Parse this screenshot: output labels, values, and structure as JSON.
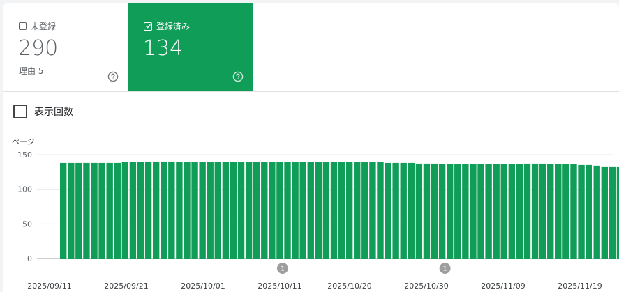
{
  "tiles": {
    "not_indexed": {
      "label": "未登録",
      "value": "290",
      "sub": "理由 5",
      "help_icon": "help-circle-icon"
    },
    "indexed": {
      "label": "登録済み",
      "value": "134",
      "help_icon": "help-circle-icon"
    }
  },
  "metric_toggle": {
    "label": "表示回数",
    "checked": false
  },
  "colors": {
    "accent": "#0f9d58",
    "bar": "#0f9d58",
    "grid": "#e8eaed",
    "annotation": "#9e9e9e"
  },
  "chart_data": {
    "type": "bar",
    "ylabel": "ページ",
    "ylim": [
      0,
      150
    ],
    "yticks": [
      "0",
      "50",
      "100",
      "150"
    ],
    "xtick_labels": [
      "2025/09/11",
      "2025/09/21",
      "2025/10/01",
      "2025/10/11",
      "2025/10/20",
      "2025/10/30",
      "2025/11/09",
      "2025/11/19"
    ],
    "series": [
      {
        "values": [
          138,
          138,
          138,
          138,
          138,
          138,
          138,
          138,
          139,
          139,
          139,
          140,
          140,
          140,
          140,
          139,
          139,
          139,
          139,
          139,
          139,
          139,
          139,
          139,
          139,
          139,
          139,
          139,
          139,
          139,
          139,
          139,
          139,
          139,
          139,
          139,
          139,
          139,
          139,
          139,
          139,
          139,
          138,
          138,
          138,
          138,
          137,
          137,
          137,
          136,
          136,
          136,
          136,
          136,
          136,
          136,
          136,
          136,
          136,
          136,
          137,
          137,
          137,
          136,
          136,
          136,
          136,
          135,
          135,
          134,
          133,
          133,
          133
        ]
      }
    ],
    "annotations": [
      {
        "label": "1",
        "bar_index": 28
      },
      {
        "label": "1",
        "bar_index": 49
      }
    ]
  }
}
